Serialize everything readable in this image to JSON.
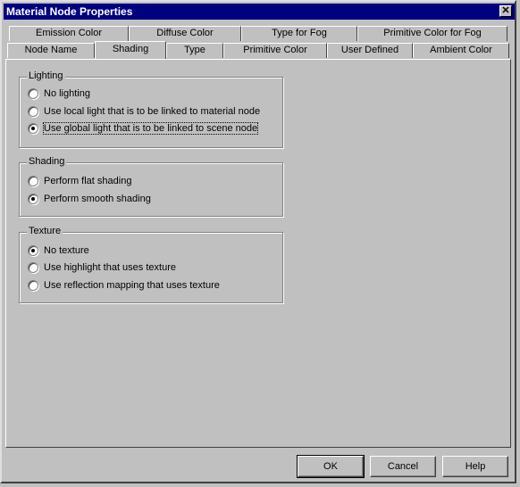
{
  "window": {
    "title": "Material Node Properties",
    "close_glyph": "✕"
  },
  "tabs_back": [
    {
      "label": "Emission Color"
    },
    {
      "label": "Diffuse Color"
    },
    {
      "label": "Type for Fog"
    },
    {
      "label": "Primitive Color for Fog"
    }
  ],
  "tabs_front": [
    {
      "label": "Node Name"
    },
    {
      "label": "Shading"
    },
    {
      "label": "Type"
    },
    {
      "label": "Primitive Color"
    },
    {
      "label": "User Defined"
    },
    {
      "label": "Ambient Color"
    }
  ],
  "selected_tab": "Shading",
  "groups": {
    "lighting": {
      "title": "Lighting",
      "options": [
        {
          "label": "No lighting",
          "checked": false
        },
        {
          "label": "Use local light that is to be linked to material node",
          "checked": false
        },
        {
          "label": "Use global light that is to be linked to scene node",
          "checked": true
        }
      ]
    },
    "shading": {
      "title": "Shading",
      "options": [
        {
          "label": "Perform flat shading",
          "checked": false
        },
        {
          "label": "Perform smooth shading",
          "checked": true
        }
      ]
    },
    "texture": {
      "title": "Texture",
      "options": [
        {
          "label": "No texture",
          "checked": true
        },
        {
          "label": "Use highlight that uses texture",
          "checked": false
        },
        {
          "label": "Use reflection mapping that uses texture",
          "checked": false
        }
      ]
    }
  },
  "buttons": {
    "ok": "OK",
    "cancel": "Cancel",
    "help": "Help"
  }
}
